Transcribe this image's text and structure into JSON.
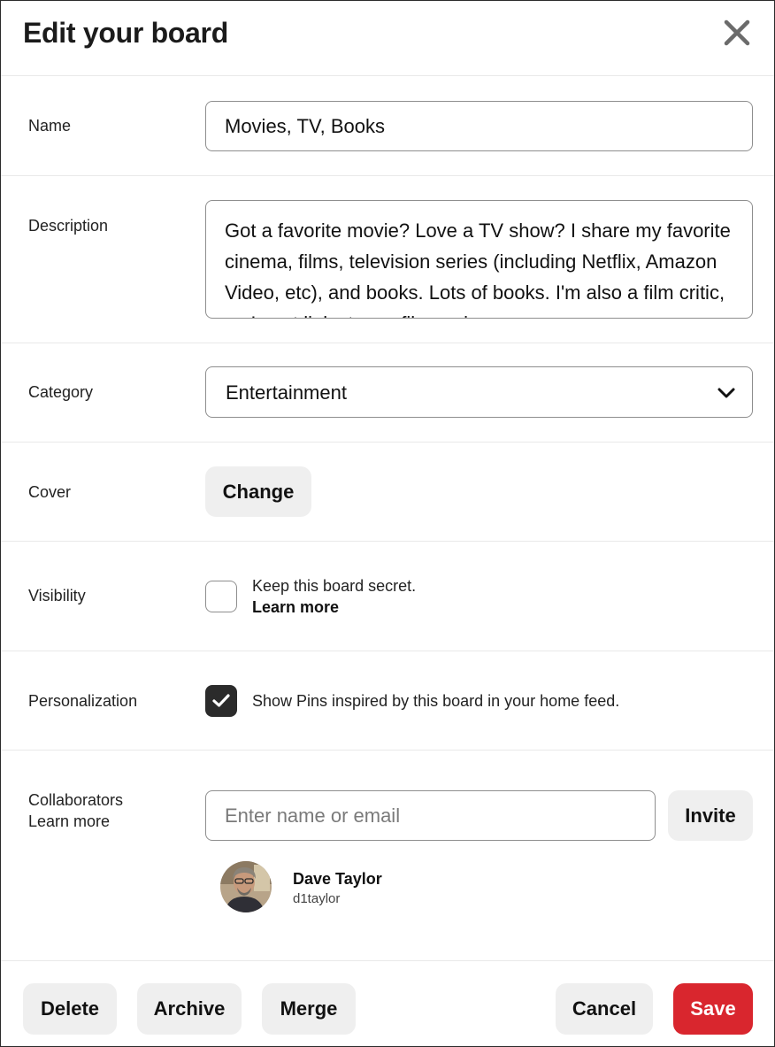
{
  "dialog": {
    "title": "Edit your board"
  },
  "form": {
    "name": {
      "label": "Name",
      "value": "Movies, TV, Books"
    },
    "description": {
      "label": "Description",
      "value": "Got a favorite movie? Love a TV show? I share my favorite cinema, films, television series (including Netflix, Amazon Video, etc), and books. Lots of books. I'm also a film critic, so I post links to my film reviews on http://www.DaveOnFilm.com/"
    },
    "category": {
      "label": "Category",
      "selected": "Entertainment"
    },
    "cover": {
      "label": "Cover",
      "button": "Change"
    },
    "visibility": {
      "label": "Visibility",
      "checked": false,
      "text": "Keep this board secret.",
      "link": "Learn more"
    },
    "personalization": {
      "label": "Personalization",
      "checked": true,
      "text": "Show Pins inspired by this board in your home feed."
    },
    "collaborators": {
      "label": "Collaborators",
      "link": "Learn more",
      "placeholder": "Enter name or email",
      "invite_button": "Invite",
      "people": [
        {
          "name": "Dave Taylor",
          "username": "d1taylor"
        }
      ]
    }
  },
  "footer": {
    "delete": "Delete",
    "archive": "Archive",
    "merge": "Merge",
    "cancel": "Cancel",
    "save": "Save"
  },
  "colors": {
    "save_button": "#d9262e",
    "secondary_button": "#efefef",
    "checkbox_checked": "#2b2b2b",
    "field_border": "#8e8e8e"
  },
  "icons": {
    "close": "close-icon",
    "dropdown": "chevron-down-icon",
    "check": "checkmark-icon"
  }
}
